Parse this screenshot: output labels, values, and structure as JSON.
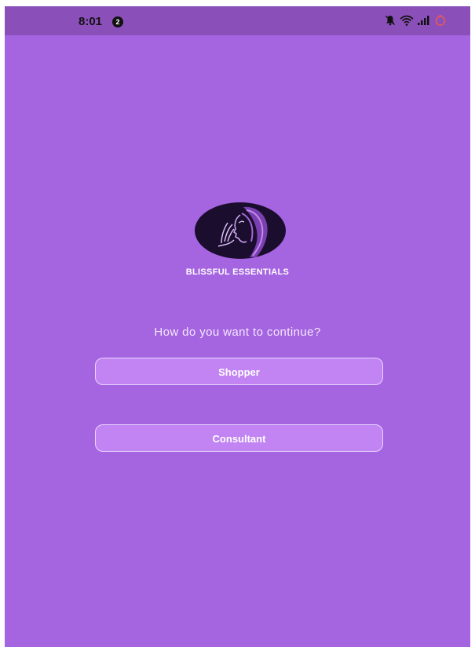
{
  "status_bar": {
    "time": "8:01",
    "notification_count": "2",
    "icons": [
      "bell-muted-icon",
      "wifi-icon",
      "signal-icon",
      "battery-icon"
    ]
  },
  "app": {
    "brand_name": "BLISSFUL ESSENTIALS",
    "prompt": "How do you want to continue?",
    "buttons": {
      "shopper": "Shopper",
      "consultant": "Consultant"
    }
  },
  "colors": {
    "background": "#a564e0",
    "status_bar": "#8a4fb8",
    "button_fill": "#c184f2",
    "button_border": "#e9d5ff",
    "logo_background": "#1a0d2e"
  }
}
